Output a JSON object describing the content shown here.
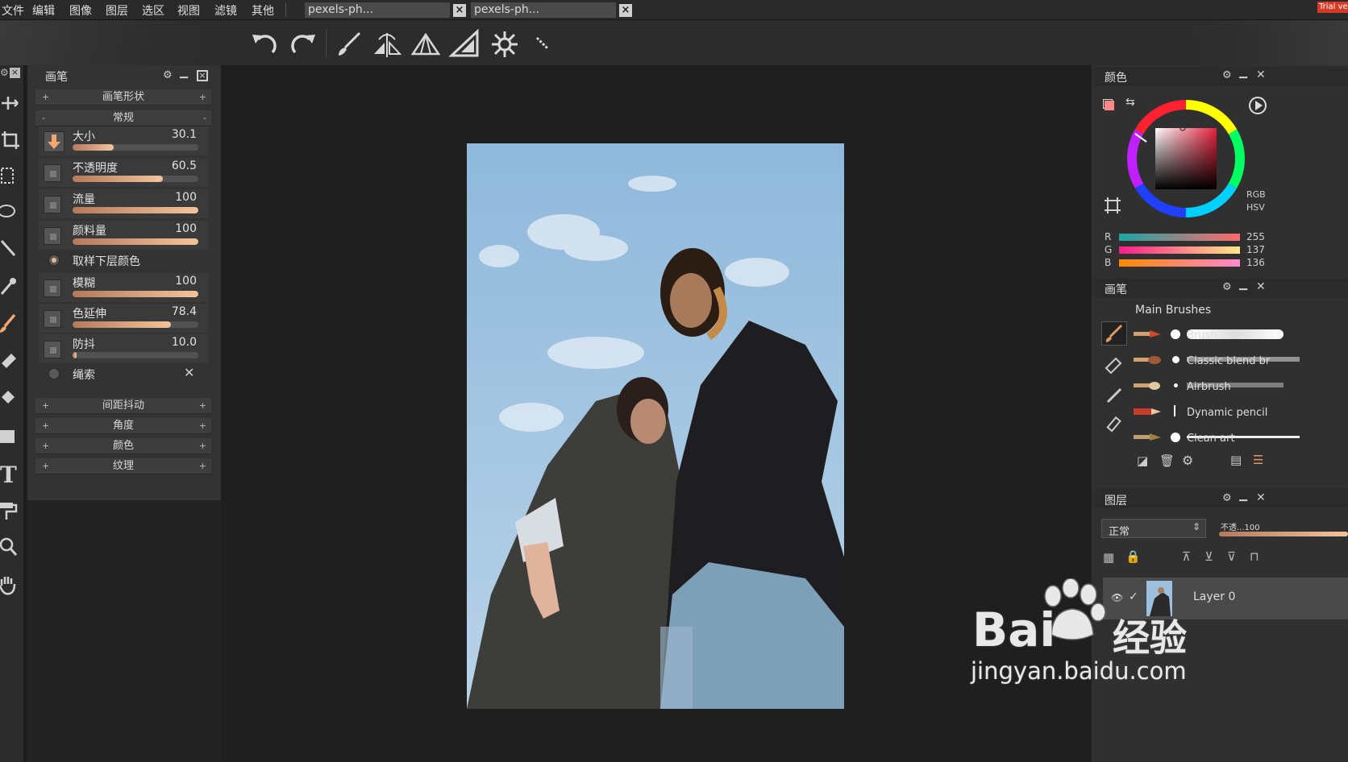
{
  "menu": [
    "文件",
    "编辑",
    "图像",
    "图层",
    "选区",
    "视图",
    "滤镜",
    "其他"
  ],
  "tabs": [
    {
      "label": "pexels-ph..."
    },
    {
      "label": "pexels-ph..."
    }
  ],
  "trial_badge": "Trial ve",
  "brush_panel": {
    "title": "画笔",
    "sections_top": [
      {
        "label": "画笔形状"
      },
      {
        "label": "常规"
      }
    ],
    "rows": [
      {
        "label": "大小",
        "value": "30.1",
        "level": 0.33
      },
      {
        "label": "不透明度",
        "value": "60.5",
        "level": 0.72
      },
      {
        "label": "流量",
        "value": "100",
        "level": 1.0
      },
      {
        "label": "颜料量",
        "value": "100",
        "level": 1.0
      },
      {
        "label": "模糊",
        "value": "100",
        "level": 1.0
      },
      {
        "label": "色延伸",
        "value": "78.4",
        "level": 0.78
      },
      {
        "label": "防抖",
        "value": "10.0",
        "level": 0.03
      }
    ],
    "sample_below": "取样下层颜色",
    "lasso": "绳索",
    "sections_bottom": [
      {
        "label": "间距抖动"
      },
      {
        "label": "角度"
      },
      {
        "label": "颜色"
      },
      {
        "label": "纹理"
      }
    ]
  },
  "color_panel": {
    "title": "颜色",
    "modes": [
      "RGB",
      "HSV"
    ],
    "rgb": [
      {
        "label": "R",
        "value": "255"
      },
      {
        "label": "G",
        "value": "137"
      },
      {
        "label": "B",
        "value": "136"
      }
    ],
    "current_color": "#ff8988"
  },
  "brushes_panel": {
    "title": "画笔",
    "set_name": "Main Brushes",
    "items": [
      {
        "name": "Brush"
      },
      {
        "name": "Classic blend br"
      },
      {
        "name": "Airbrush"
      },
      {
        "name": "Dynamic pencil"
      },
      {
        "name": "Clean art"
      }
    ]
  },
  "layers_panel": {
    "title": "图层",
    "blend_mode": "正常",
    "opacity": "不透...100",
    "layers": [
      {
        "name": "Layer 0"
      }
    ]
  },
  "watermark": {
    "brand": "Bai",
    "brand_cn": "经验",
    "url": "jingyan.baidu.com"
  }
}
